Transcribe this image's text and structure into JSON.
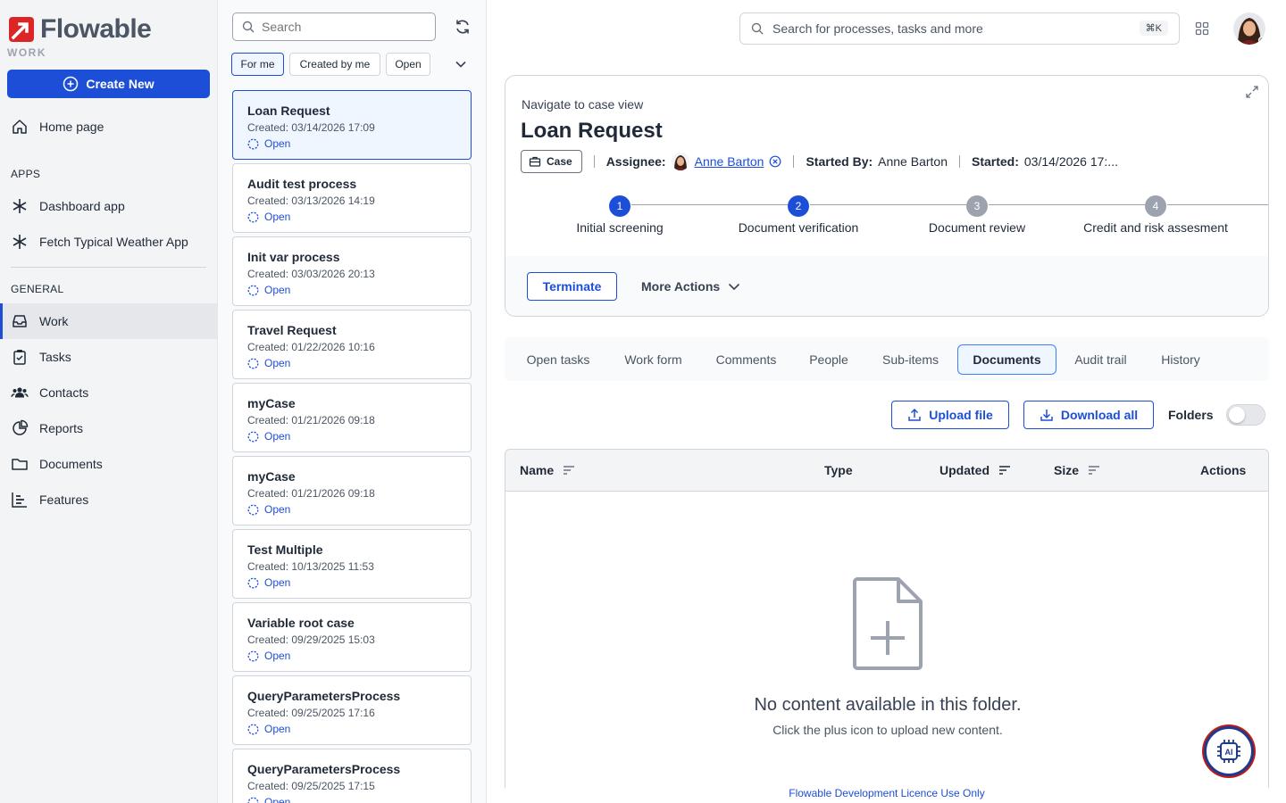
{
  "brand": {
    "name": "Flowable",
    "sub": "WORK",
    "primary_color": "#1d4ed8"
  },
  "sidebar": {
    "create_label": "Create New",
    "home_label": "Home page",
    "apps_heading": "APPS",
    "apps": [
      {
        "label": "Dashboard app",
        "icon": "asterisk-icon"
      },
      {
        "label": "Fetch Typical Weather App",
        "icon": "asterisk-icon"
      }
    ],
    "general_heading": "GENERAL",
    "items": [
      {
        "label": "Work",
        "icon": "inbox-icon",
        "active": true
      },
      {
        "label": "Tasks",
        "icon": "clipboard-icon"
      },
      {
        "label": "Contacts",
        "icon": "users-icon"
      },
      {
        "label": "Reports",
        "icon": "pie-chart-icon"
      },
      {
        "label": "Documents",
        "icon": "folder-icon"
      },
      {
        "label": "Features",
        "icon": "bar-chart-icon"
      }
    ]
  },
  "list": {
    "search_placeholder": "Search",
    "filters": [
      "For me",
      "Created by me",
      "Open"
    ],
    "items": [
      {
        "title": "Loan Request",
        "created": "Created: 03/14/2026 17:09",
        "status": "Open"
      },
      {
        "title": "Audit test process",
        "created": "Created: 03/13/2026 14:19",
        "status": "Open"
      },
      {
        "title": "Init var process",
        "created": "Created: 03/03/2026 20:13",
        "status": "Open"
      },
      {
        "title": "Travel Request",
        "created": "Created: 01/22/2026 10:16",
        "status": "Open"
      },
      {
        "title": "myCase",
        "created": "Created: 01/21/2026 09:18",
        "status": "Open"
      },
      {
        "title": "myCase",
        "created": "Created: 01/21/2026 09:18",
        "status": "Open"
      },
      {
        "title": "Test Multiple",
        "created": "Created: 10/13/2025 11:53",
        "status": "Open"
      },
      {
        "title": "Variable root case",
        "created": "Created: 09/29/2025 15:03",
        "status": "Open"
      },
      {
        "title": "QueryParametersProcess",
        "created": "Created: 09/25/2025 17:16",
        "status": "Open"
      },
      {
        "title": "QueryParametersProcess",
        "created": "Created: 09/25/2025 17:15",
        "status": "Open"
      }
    ]
  },
  "topbar": {
    "search_placeholder": "Search for processes, tasks and more",
    "shortcut": "⌘K"
  },
  "case": {
    "navigate_label": "Navigate to case view",
    "title": "Loan Request",
    "badge": "Case",
    "assignee_label": "Assignee:",
    "assignee": "Anne Barton",
    "started_by_label": "Started By:",
    "started_by": "Anne Barton",
    "started_label": "Started:",
    "started": "03/14/2026 17:...",
    "steps": [
      {
        "num": "1",
        "label": "Initial screening",
        "active": true
      },
      {
        "num": "2",
        "label": "Document verification",
        "active": true
      },
      {
        "num": "3",
        "label": "Document review",
        "active": false
      },
      {
        "num": "4",
        "label": "Credit and risk assesment",
        "active": false
      }
    ],
    "terminate_label": "Terminate",
    "more_actions_label": "More Actions"
  },
  "tabs": [
    "Open tasks",
    "Work form",
    "Comments",
    "People",
    "Sub-items",
    "Documents",
    "Audit trail",
    "History"
  ],
  "documents": {
    "upload_label": "Upload file",
    "download_label": "Download all",
    "folders_label": "Folders",
    "columns": [
      "Name",
      "Type",
      "Updated",
      "Size",
      "Actions"
    ],
    "empty_title": "No content available in this folder.",
    "empty_sub": "Click the plus icon to upload new content."
  },
  "footer": "Flowable Development Licence Use Only"
}
